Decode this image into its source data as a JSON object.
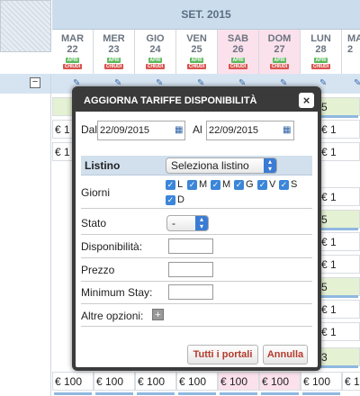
{
  "calendar": {
    "month": "SET. 2015",
    "days": [
      {
        "name": "MAR",
        "num": "22",
        "weekend": false
      },
      {
        "name": "MER",
        "num": "23",
        "weekend": false
      },
      {
        "name": "GIO",
        "num": "24",
        "weekend": false
      },
      {
        "name": "VEN",
        "num": "25",
        "weekend": false
      },
      {
        "name": "SAB",
        "num": "26",
        "weekend": true
      },
      {
        "name": "DOM",
        "num": "27",
        "weekend": true
      },
      {
        "name": "LUN",
        "num": "28",
        "weekend": false
      },
      {
        "name": "MA",
        "num": "2",
        "weekend": false
      }
    ],
    "tag_open": "APRI",
    "tag_close": "CHIUDI",
    "price": "€ 100",
    "partial": "€ 1",
    "digit5": "5",
    "digit3": "3",
    "minus": "−"
  },
  "dialog": {
    "title": "AGGIORNA TARIFFE DISPONIBILITÀ",
    "close": "×",
    "from_label": "Dal",
    "from_value": "22/09/2015",
    "to_label": "Al",
    "to_value": "22/09/2015",
    "listino_label": "Listino",
    "listino_value": "Seleziona listino",
    "giorni_label": "Giorni",
    "giorni": [
      "L",
      "M",
      "M",
      "G",
      "V",
      "S",
      "D"
    ],
    "stato_label": "Stato",
    "stato_value": "-",
    "disponibilita_label": "Disponibilità:",
    "prezzo_label": "Prezzo",
    "minstay_label": "Minimum Stay:",
    "altre_label": "Altre opzioni:",
    "plus": "+",
    "btn_all": "Tutti i portali",
    "btn_cancel": "Annulla"
  }
}
